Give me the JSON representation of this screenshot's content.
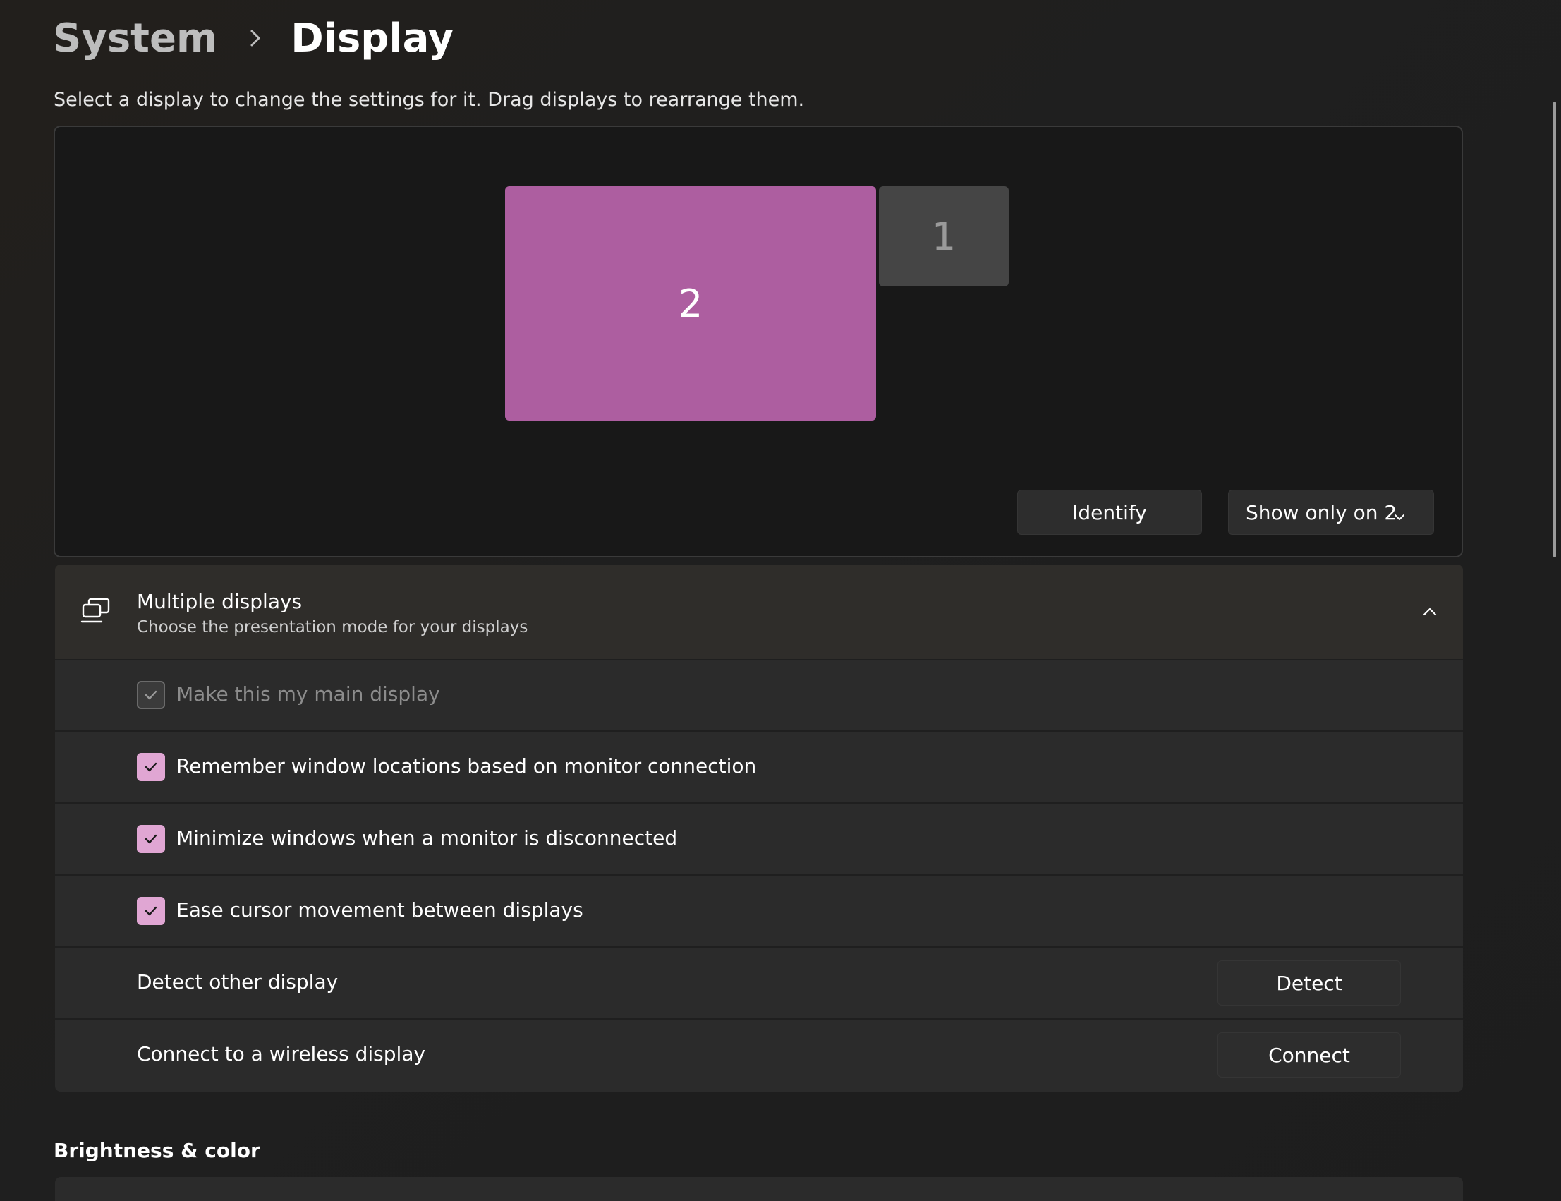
{
  "breadcrumb": {
    "parent": "System",
    "current": "Display"
  },
  "instructions": "Select a display to change the settings for it. Drag displays to rearrange them.",
  "arrangement": {
    "monitors": [
      {
        "label": "2",
        "selected": true,
        "color": "#ad5ea0"
      },
      {
        "label": "1",
        "selected": false,
        "color": "#454545"
      }
    ],
    "identify_label": "Identify",
    "mode_select_value": "Show only on 2"
  },
  "multiple_displays": {
    "title": "Multiple displays",
    "subtitle": "Choose the presentation mode for your displays",
    "expanded": true,
    "options": [
      {
        "label": "Make this my main display",
        "checked": true,
        "disabled": true
      },
      {
        "label": "Remember window locations based on monitor connection",
        "checked": true,
        "disabled": false
      },
      {
        "label": "Minimize windows when a monitor is disconnected",
        "checked": true,
        "disabled": false
      },
      {
        "label": "Ease cursor movement between displays",
        "checked": true,
        "disabled": false
      }
    ],
    "detect_row": {
      "label": "Detect other display",
      "button": "Detect"
    },
    "connect_row": {
      "label": "Connect to a wireless display",
      "button": "Connect"
    }
  },
  "brightness_section_title": "Brightness & color",
  "colors": {
    "accent": "#e0a6d3",
    "selected_monitor": "#ad5ea0"
  }
}
